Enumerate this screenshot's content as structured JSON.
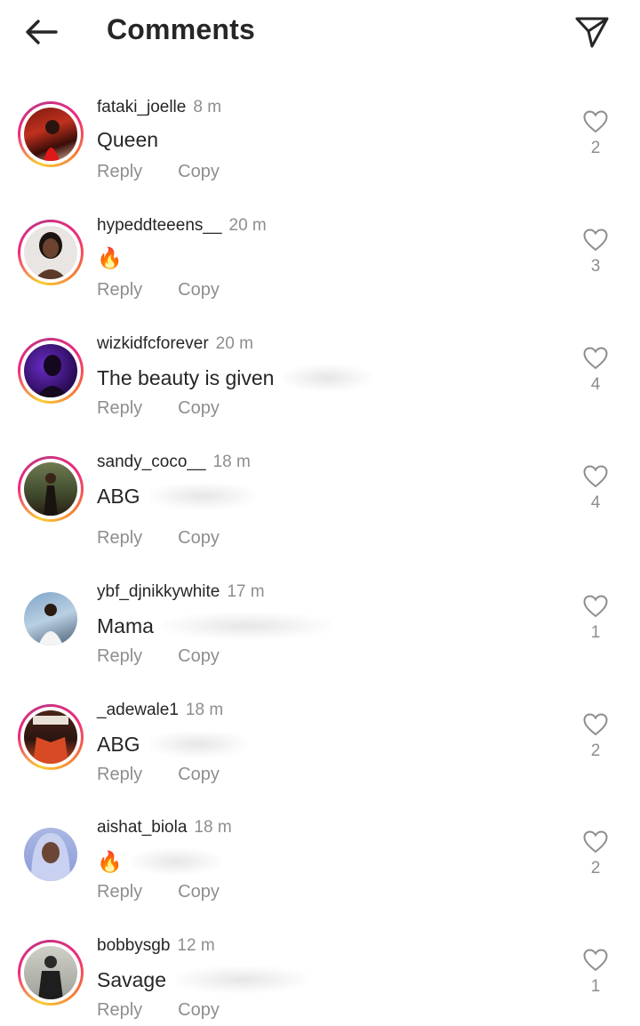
{
  "header": {
    "title": "Comments",
    "back_icon": "arrow-left-icon",
    "send_icon": "paper-plane-icon"
  },
  "actions": {
    "reply": "Reply",
    "copy": "Copy"
  },
  "colors": {
    "text": "#262626",
    "secondary": "#8e8e8e",
    "story_ring": [
      "#f9ce34",
      "#ee2a7b",
      "#c13584"
    ]
  },
  "comments": [
    {
      "username": "fataki_joelle",
      "time": "8 m",
      "text": "Queen",
      "likes": "2",
      "story_ring": true
    },
    {
      "username": "hypeddteeens__",
      "time": "20 m",
      "text": "🔥",
      "likes": "3",
      "story_ring": true
    },
    {
      "username": "wizkidfcforever",
      "time": "20 m",
      "text": "The beauty is given",
      "likes": "4",
      "story_ring": true
    },
    {
      "username": "sandy_coco__",
      "time": "18 m",
      "text": "ABG",
      "likes": "4",
      "story_ring": true
    },
    {
      "username": "ybf_djnikkywhite",
      "time": "17 m",
      "text": "Mama",
      "likes": "1",
      "story_ring": false
    },
    {
      "username": "_adewale1",
      "time": "18 m",
      "text": "ABG",
      "likes": "2",
      "story_ring": true
    },
    {
      "username": "aishat_biola",
      "time": "18 m",
      "text": "🔥",
      "likes": "2",
      "story_ring": false
    },
    {
      "username": "bobbysgb",
      "time": "12 m",
      "text": "Savage",
      "likes": "1",
      "story_ring": true
    }
  ]
}
